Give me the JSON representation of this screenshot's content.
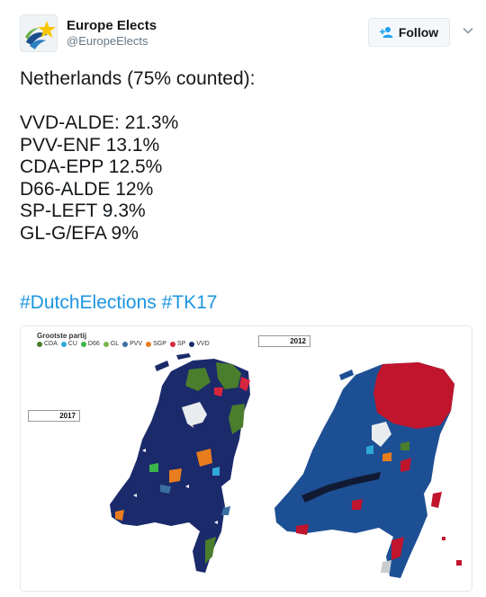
{
  "user": {
    "display_name": "Europe Elects",
    "handle": "@EuropeElects",
    "follow_label": "Follow"
  },
  "tweet": {
    "lines": [
      "Netherlands (75% counted):",
      "",
      "VVD-ALDE: 21.3%",
      "PVV-ENF 13.1%",
      "CDA-EPP 12.5%",
      "D66-ALDE 12%",
      "SP-LEFT 9.3%",
      "GL-G/EFA 9%"
    ],
    "hashtags": [
      "#DutchElections",
      "#TK17"
    ]
  },
  "image": {
    "legend_title": "Grootste partij",
    "legend": [
      {
        "label": "CDA",
        "color": "#4a7d2c"
      },
      {
        "label": "CU",
        "color": "#2fa8d8"
      },
      {
        "label": "D66",
        "color": "#3ab54a"
      },
      {
        "label": "GL",
        "color": "#7ab648"
      },
      {
        "label": "PVV",
        "color": "#3b6fa0"
      },
      {
        "label": "SGP",
        "color": "#e87d1e"
      },
      {
        "label": "SP",
        "color": "#d7263d"
      },
      {
        "label": "VVD",
        "color": "#1b2a6b"
      }
    ],
    "year_left": "2017",
    "year_right": "2012"
  },
  "colors": {
    "vvd_navy": "#1b2a6b",
    "pvv_blue": "#1d4f94",
    "cda_green": "#4a7d2c",
    "sp_red": "#c0152d",
    "sgp_orange": "#e87d1e",
    "link_blue": "#1b95e0"
  }
}
